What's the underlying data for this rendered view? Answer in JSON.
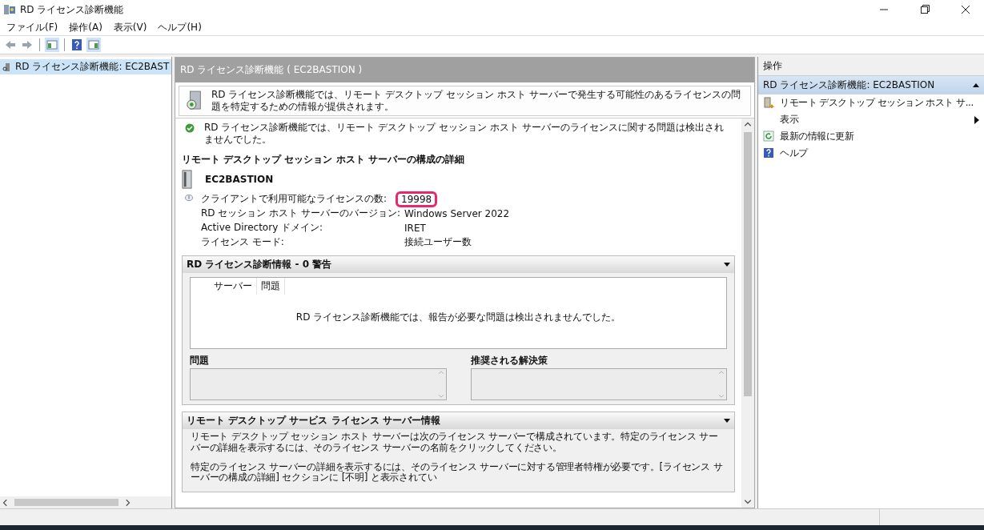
{
  "window": {
    "title": "RD ライセンス診断機能"
  },
  "menu": [
    "ファイル(F)",
    "操作(A)",
    "表示(V)",
    "ヘルプ(H)"
  ],
  "tree": {
    "items": [
      {
        "label": "RD ライセンス診断機能: EC2BAST",
        "selected": true
      }
    ]
  },
  "center": {
    "title": "RD ライセンス診断機能 ( EC2BASTION )",
    "intro": "RD ライセンス診断機能では、リモート デスクトップ セッション ホスト サーバーで発生する可能性のあるライセンスの問題を特定するための情報が提供されます。",
    "status": "RD ライセンス診断機能では、リモート デスクトップ セッション ホスト サーバーのライセンスに関する問題は検出されませんでした。",
    "config_heading": "リモート デスクトップ セッション ホスト サーバーの構成の詳細",
    "server_name": "EC2BASTION",
    "properties": [
      {
        "label": "クライアントで利用可能なライセンスの数:",
        "value": "19998",
        "highlighted": true
      },
      {
        "label": "RD セッション ホスト サーバーのバージョン:",
        "value": "Windows Server 2022",
        "highlighted": false
      },
      {
        "label": "Active Directory ドメイン:",
        "value": "IRET",
        "highlighted": false
      },
      {
        "label": "ライセンス モード:",
        "value": "接続ユーザー数",
        "highlighted": false
      }
    ],
    "diagnostics": {
      "title": "RD ライセンス診断情報 - 0 警告",
      "columns": [
        "サーバー",
        "問題"
      ],
      "empty_message": "RD ライセンス診断機能では、報告が必要な問題は検出されませんでした。",
      "problem_label": "問題",
      "solution_label": "推奨される解決策"
    },
    "license_servers": {
      "title": "リモート デスクトップ サービス ライセンス サーバー情報",
      "paragraphs": [
        "リモート デスクトップ セッション ホスト サーバーは次のライセンス サーバーで構成されています。特定のライセンス サーバーの詳細を表示するには、そのライセンス サーバーの名前をクリックしてください。",
        "特定のライセンス サーバーの詳細を表示するには、そのライセンス サーバーに対する管理者特権が必要です。[ライセンス サーバーの構成の詳細] セクションに [不明] と表示されてい"
      ]
    }
  },
  "actions": {
    "title": "操作",
    "group": "RD ライセンス診断機能: EC2BASTION",
    "items": [
      {
        "kind": "server",
        "label": "リモート デスクトップ セッション ホスト サ..."
      },
      {
        "kind": "submenu",
        "label": "表示"
      },
      {
        "kind": "refresh",
        "label": "最新の情報に更新"
      },
      {
        "kind": "help",
        "label": "ヘルプ"
      }
    ]
  }
}
